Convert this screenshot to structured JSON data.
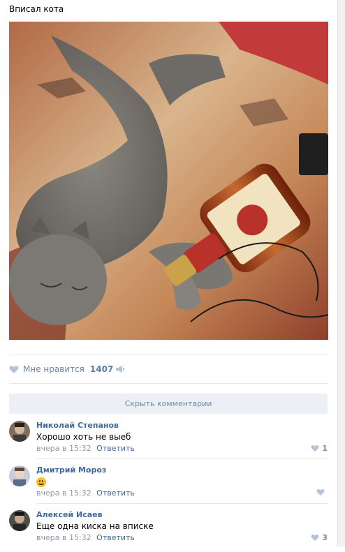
{
  "post": {
    "text": "Вписал кота",
    "photo_alt": "cat-with-bottle-photo"
  },
  "likes": {
    "label": "Мне нравится",
    "count": "1407"
  },
  "hide_comments_label": "Скрыть комментарии",
  "comments": [
    {
      "author": "Николай Степанов",
      "text": "Хорошо хоть не выеб",
      "time": "вчера в 15:32",
      "reply": "Ответить",
      "likes": "1"
    },
    {
      "author": "Дмитрий Мороз",
      "text": "",
      "emoji": "grin-emoji",
      "time": "вчера в 15:32",
      "reply": "Ответить",
      "likes": ""
    },
    {
      "author": "Алексей Исаев",
      "text": "Еще одна киска на вписке",
      "time": "вчера в 15:32",
      "reply": "Ответить",
      "likes": "3"
    }
  ],
  "colors": {
    "link": "#3f6a9a",
    "meta": "#8d9aab",
    "button_bg": "#eceff3"
  }
}
